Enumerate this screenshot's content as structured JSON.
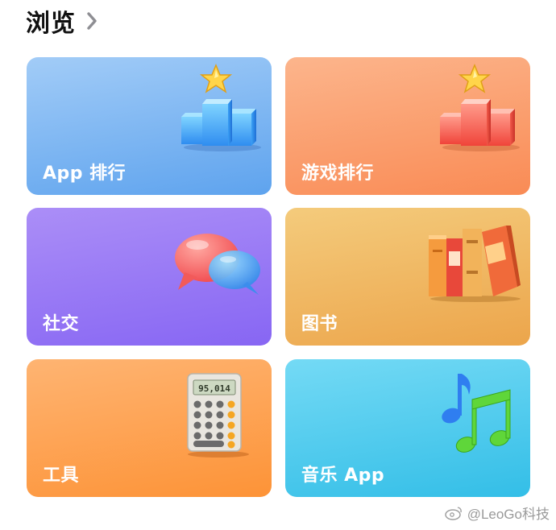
{
  "header": {
    "title": "浏览"
  },
  "cards": [
    {
      "label": "App 排行",
      "icon": "podium-star-icon",
      "gradient": [
        "#9cc8f6",
        "#5da2ee"
      ]
    },
    {
      "label": "游戏排行",
      "icon": "podium-star-icon",
      "gradient": [
        "#fcb38a",
        "#f98a54"
      ]
    },
    {
      "label": "社交",
      "icon": "chat-bubbles-icon",
      "gradient": [
        "#a98cf6",
        "#8868f4"
      ]
    },
    {
      "label": "图书",
      "icon": "books-icon",
      "gradient": [
        "#f3c878",
        "#eca44c"
      ]
    },
    {
      "label": "工具",
      "icon": "calculator-icon",
      "gradient": [
        "#feb270",
        "#fd9436"
      ]
    },
    {
      "label": "音乐 App",
      "icon": "music-notes-icon",
      "gradient": [
        "#6fd8f4",
        "#33bfe8"
      ]
    }
  ],
  "calculator": {
    "display": "95,014"
  },
  "watermark": {
    "text": "@LeoGo科技"
  }
}
